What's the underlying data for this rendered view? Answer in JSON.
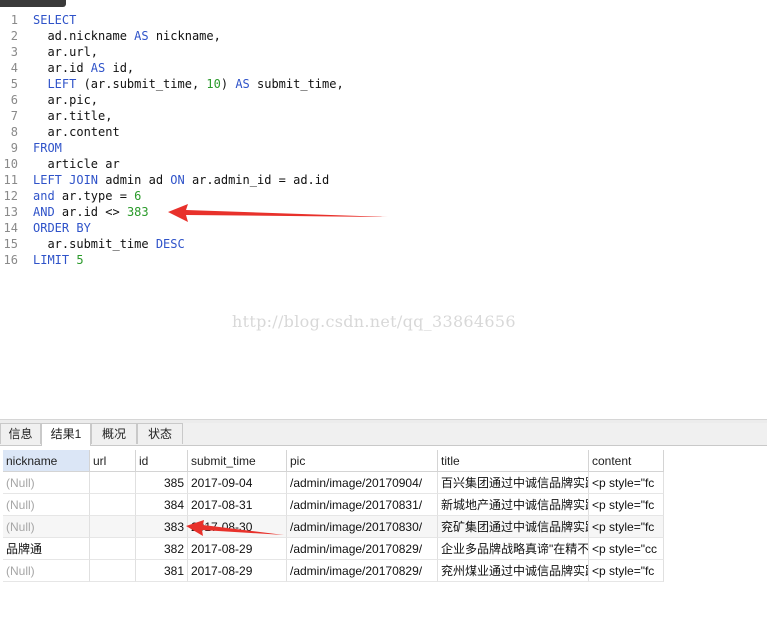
{
  "editor": {
    "lines": [
      {
        "n": "1",
        "tokens": [
          {
            "t": "SELECT",
            "c": "kw"
          }
        ]
      },
      {
        "n": "2",
        "tokens": [
          {
            "t": "  ad.nickname ",
            "c": ""
          },
          {
            "t": "AS",
            "c": "kw"
          },
          {
            "t": " nickname,",
            "c": ""
          }
        ]
      },
      {
        "n": "3",
        "tokens": [
          {
            "t": "  ar.url,",
            "c": ""
          }
        ]
      },
      {
        "n": "4",
        "tokens": [
          {
            "t": "  ar.id ",
            "c": ""
          },
          {
            "t": "AS",
            "c": "kw"
          },
          {
            "t": " id,",
            "c": ""
          }
        ]
      },
      {
        "n": "5",
        "tokens": [
          {
            "t": "  ",
            "c": ""
          },
          {
            "t": "LEFT",
            "c": "kw"
          },
          {
            "t": " (ar.submit_time, ",
            "c": ""
          },
          {
            "t": "10",
            "c": "num"
          },
          {
            "t": ") ",
            "c": ""
          },
          {
            "t": "AS",
            "c": "kw"
          },
          {
            "t": " submit_time,",
            "c": ""
          }
        ]
      },
      {
        "n": "6",
        "tokens": [
          {
            "t": "  ar.pic,",
            "c": ""
          }
        ]
      },
      {
        "n": "7",
        "tokens": [
          {
            "t": "  ar.title,",
            "c": ""
          }
        ]
      },
      {
        "n": "8",
        "tokens": [
          {
            "t": "  ar.content",
            "c": ""
          }
        ]
      },
      {
        "n": "9",
        "tokens": [
          {
            "t": "FROM",
            "c": "kw"
          }
        ]
      },
      {
        "n": "10",
        "tokens": [
          {
            "t": "  article ar",
            "c": ""
          }
        ]
      },
      {
        "n": "11",
        "tokens": [
          {
            "t": "LEFT JOIN",
            "c": "kw"
          },
          {
            "t": " admin ad ",
            "c": ""
          },
          {
            "t": "ON",
            "c": "kw"
          },
          {
            "t": " ar.admin_id = ad.id",
            "c": ""
          }
        ]
      },
      {
        "n": "12",
        "tokens": [
          {
            "t": "and",
            "c": "kw"
          },
          {
            "t": " ar.type = ",
            "c": ""
          },
          {
            "t": "6",
            "c": "num"
          }
        ]
      },
      {
        "n": "13",
        "tokens": [
          {
            "t": "AND",
            "c": "kw"
          },
          {
            "t": " ar.id <> ",
            "c": ""
          },
          {
            "t": "383",
            "c": "num"
          }
        ]
      },
      {
        "n": "14",
        "tokens": [
          {
            "t": "ORDER BY",
            "c": "kw"
          }
        ]
      },
      {
        "n": "15",
        "tokens": [
          {
            "t": "  ar.submit_time ",
            "c": ""
          },
          {
            "t": "DESC",
            "c": "kw"
          }
        ]
      },
      {
        "n": "16",
        "tokens": [
          {
            "t": "LIMIT",
            "c": "kw"
          },
          {
            "t": " ",
            "c": ""
          },
          {
            "t": "5",
            "c": "num"
          }
        ]
      }
    ]
  },
  "watermark": "http://blog.csdn.net/qq_33864656",
  "tabs": [
    "信息",
    "结果1",
    "概况",
    "状态"
  ],
  "active_tab": "结果1",
  "result": {
    "columns": [
      "nickname",
      "url",
      "id",
      "submit_time",
      "pic",
      "title",
      "content"
    ],
    "rows": [
      [
        "(Null)",
        "",
        "385",
        "2017-09-04",
        "/admin/image/20170904/",
        "百兴集团通过中诚信品牌实践",
        "<p style=\"fc"
      ],
      [
        "(Null)",
        "",
        "384",
        "2017-08-31",
        "/admin/image/20170831/",
        "新城地产通过中诚信品牌实践",
        "<p style=\"fc"
      ],
      [
        "(Null)",
        "",
        "383",
        "2017-08-30",
        "/admin/image/20170830/",
        "兖矿集团通过中诚信品牌实践",
        "<p style=\"fc"
      ],
      [
        "品牌通",
        "",
        "382",
        "2017-08-29",
        "/admin/image/20170829/",
        "企业多品牌战略真谛\"在精不",
        "<p style=\"cc"
      ],
      [
        "(Null)",
        "",
        "381",
        "2017-08-29",
        "/admin/image/20170829/",
        "兖州煤业通过中诚信品牌实践",
        "<p style=\"fc"
      ]
    ]
  },
  "colors": {
    "keyword": "#2f53c9",
    "number": "#2a9a2a",
    "arrow": "#e8312b",
    "null": "#a6a6a6"
  }
}
